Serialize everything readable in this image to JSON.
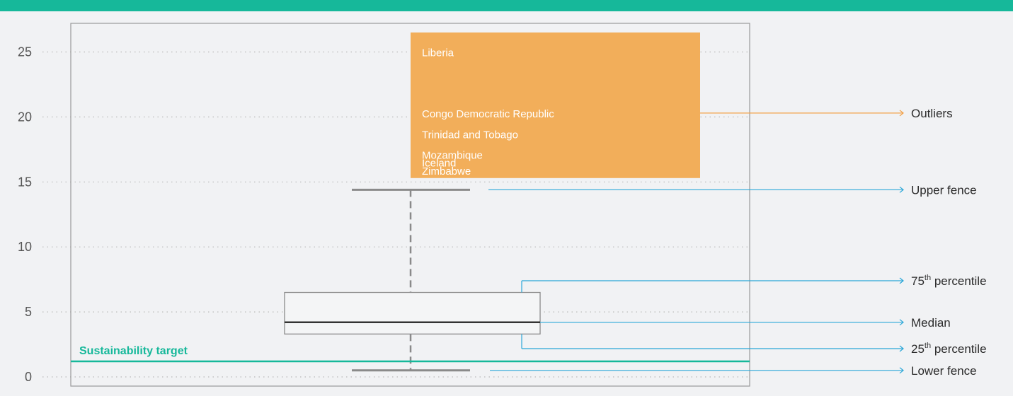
{
  "chart_data": {
    "type": "box",
    "ylim": [
      -0.5,
      27
    ],
    "y_ticks": [
      0,
      5,
      10,
      15,
      20,
      25
    ],
    "grid": "dotted-horizontal",
    "box": {
      "lower_fence": 0.5,
      "q1": 3.3,
      "median": 4.2,
      "q3": 6.5,
      "upper_fence": 14.4
    },
    "sustainability_target": {
      "label": "Sustainability target",
      "value": 1.2
    },
    "outliers_region": {
      "y_min": 15.3,
      "y_max": 26.5
    },
    "outliers": [
      {
        "name": "Liberia",
        "value": 25.0
      },
      {
        "name": "Congo Democratic Republic",
        "value": 20.3
      },
      {
        "name": "Trinidad and Tobago",
        "value": 18.7
      },
      {
        "name": "Mozambique",
        "value": 17.1
      },
      {
        "name": "Iceland",
        "value": 16.5
      },
      {
        "name": "Zimbabwe",
        "value": 15.9
      }
    ],
    "annotations": {
      "outliers": "Outliers",
      "upper_fence": "Upper fence",
      "percentile_75_num": "75",
      "percentile_75_sup": "th",
      "percentile_75_word": " percentile",
      "median": "Median",
      "percentile_25_num": "25",
      "percentile_25_sup": "th",
      "percentile_25_word": " percentile",
      "lower_fence": "Lower fence"
    }
  },
  "colors": {
    "header": "#16b89a",
    "outlier_box": "#f2ae5a",
    "teal": "#16b89a",
    "leader_blue": "#2aa7d8",
    "leader_orange": "#f2a24a",
    "box_stroke": "#8a8a8a",
    "median": "#333333"
  }
}
